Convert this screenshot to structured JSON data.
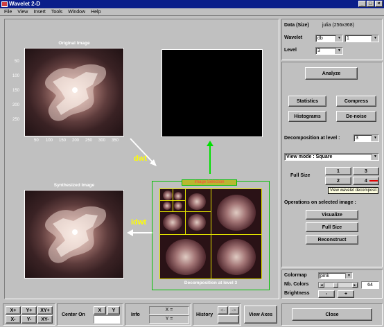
{
  "window": {
    "title": "Wavelet 2-D",
    "controls": [
      "_",
      "□",
      "×"
    ]
  },
  "menu": [
    "File",
    "View",
    "Insert",
    "Tools",
    "Window",
    "Help"
  ],
  "main": {
    "original_title": "Original Image",
    "synth_title": "Synthesized Image",
    "yticks": [
      "50",
      "100",
      "150",
      "200",
      "250"
    ],
    "xticks": [
      "50",
      "100",
      "150",
      "200",
      "250",
      "300",
      "350"
    ],
    "dwt_label": "dwt",
    "idwt_label": "idwt",
    "image_selection_label": "Image Selection",
    "decomp_caption": "Decomposition at level 3",
    "arrow_color": "#ffffff",
    "up_arrow_color": "#00e000"
  },
  "panel": {
    "data_label": "Data  (Size)",
    "data_value": "julia  (256x368)",
    "wavelet_label": "Wavelet",
    "wavelet_family": "db",
    "wavelet_number": "1",
    "level_label": "Level",
    "level_value": "3",
    "analyze": "Analyze",
    "statistics": "Statistics",
    "compress": "Compress",
    "histograms": "Histograms",
    "denoise": "De-noise",
    "decomp_level_label": "Decomposition at level :",
    "decomp_level_value": "3",
    "view_mode": "View mode : Square",
    "full_size_label": "Full Size",
    "fs1": "1",
    "fs2": "2",
    "fs3": "3",
    "fs4": "4",
    "tooltip": "View wavelet decomposit",
    "ops_label": "Operations on selected image :",
    "visualize": "Visualize",
    "full_size": "Full Size",
    "reconstruct": "Reconstruct",
    "colormap_label": "Colormap",
    "colormap_value": "pink",
    "nb_colors_label": "Nb. Colors",
    "nb_colors_value": "64",
    "brightness_label": "Brightness",
    "minus": "-",
    "plus": "+",
    "close": "Close"
  },
  "bottom": {
    "xp": "X+",
    "yp": "Y+",
    "xyp": "XY+",
    "xm": "X-",
    "ym": "Y-",
    "xym": "XY-",
    "center_on": "Center On",
    "x": "X",
    "y": "Y",
    "info": "Info",
    "x_eq": "X =",
    "y_eq": "Y =",
    "history": "History",
    "back": "<-",
    "fwd": "->",
    "view_axes": "View Axes"
  }
}
